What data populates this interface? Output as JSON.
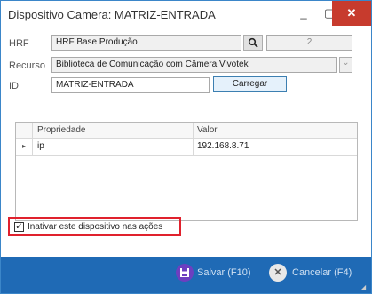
{
  "window": {
    "title": "Dispositivo Camera: MATRIZ-ENTRADA"
  },
  "titlebar": {
    "minimize": "_",
    "maximize": "▢",
    "close": "✕"
  },
  "form": {
    "hrf_label": "HRF",
    "hrf_value": "HRF Base Produção",
    "hrf_search_icon": "search-icon",
    "hrf_count": "2",
    "recurso_label": "Recurso",
    "recurso_value": "Biblioteca de Comunicação com Câmera Vivotek",
    "recurso_dropdown": "⌄",
    "id_label": "ID",
    "id_value": "MATRIZ-ENTRADA",
    "carregar_label": "Carregar"
  },
  "grid": {
    "columns": [
      "Propriedade",
      "Valor"
    ],
    "rows": [
      {
        "marker": "▸",
        "property": "ip",
        "value": "192.168.8.71"
      }
    ]
  },
  "checkbox": {
    "label": "Inativar este dispositivo nas ações",
    "checked": true,
    "mark": "✓"
  },
  "footer": {
    "save_label": "Salvar (F10)",
    "save_icon": "floppy-icon",
    "cancel_label": "Cancelar (F4)",
    "cancel_icon": "close-circle-icon"
  },
  "colors": {
    "accent": "#1f6ab5",
    "highlight": "#e0212d",
    "close": "#c73b2d"
  }
}
